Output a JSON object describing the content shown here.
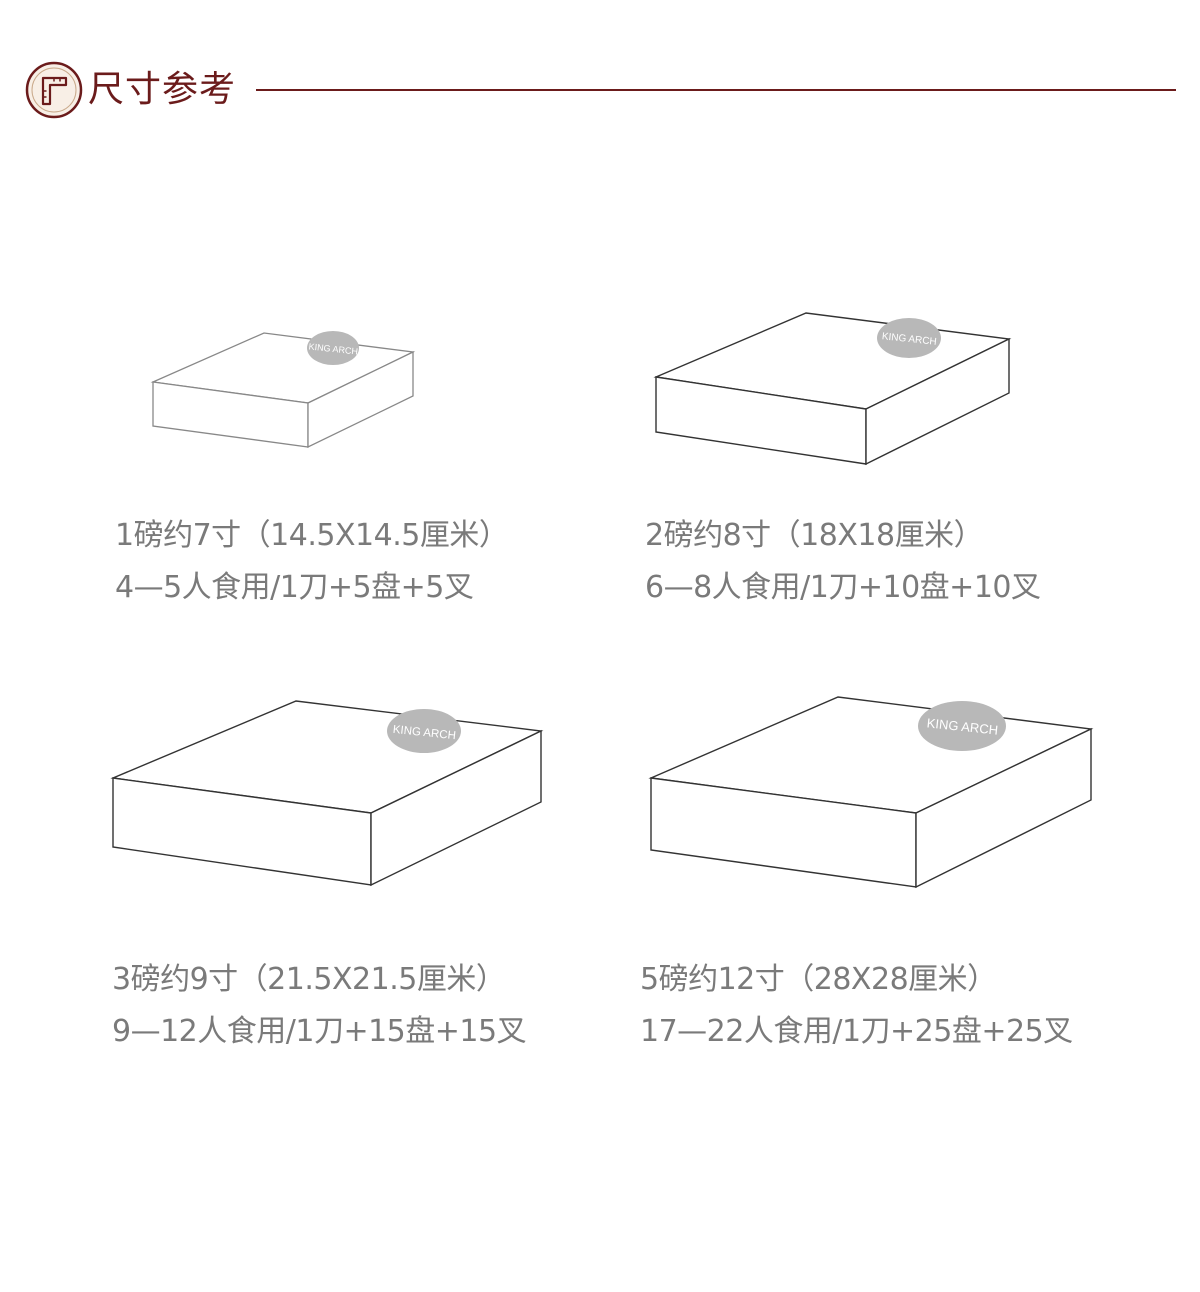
{
  "section": {
    "title": "尺寸参考",
    "accent_color": "#6b1b1b",
    "badge_icon": "ruler-corner-icon"
  },
  "brand": {
    "stamp_label": "KING ARCH",
    "stamp_color": "#b8b8b8"
  },
  "products": [
    {
      "size_line": "1磅约7寸（14.5X14.5厘米）",
      "serving_line": "4—5人食用/1刀+5盘+5叉"
    },
    {
      "size_line": "2磅约8寸（18X18厘米）",
      "serving_line": "6—8人食用/1刀+10盘+10叉"
    },
    {
      "size_line": "3磅约9寸（21.5X21.5厘米）",
      "serving_line": "9—12人食用/1刀+15盘+15叉"
    },
    {
      "size_line": "5磅约12寸（28X28厘米）",
      "serving_line": "17—22人食用/1刀+25盘+25叉"
    }
  ],
  "colors": {
    "box_stroke": "#333333",
    "box_face": "#ffffff",
    "caption_text": "#7a7a7a"
  }
}
